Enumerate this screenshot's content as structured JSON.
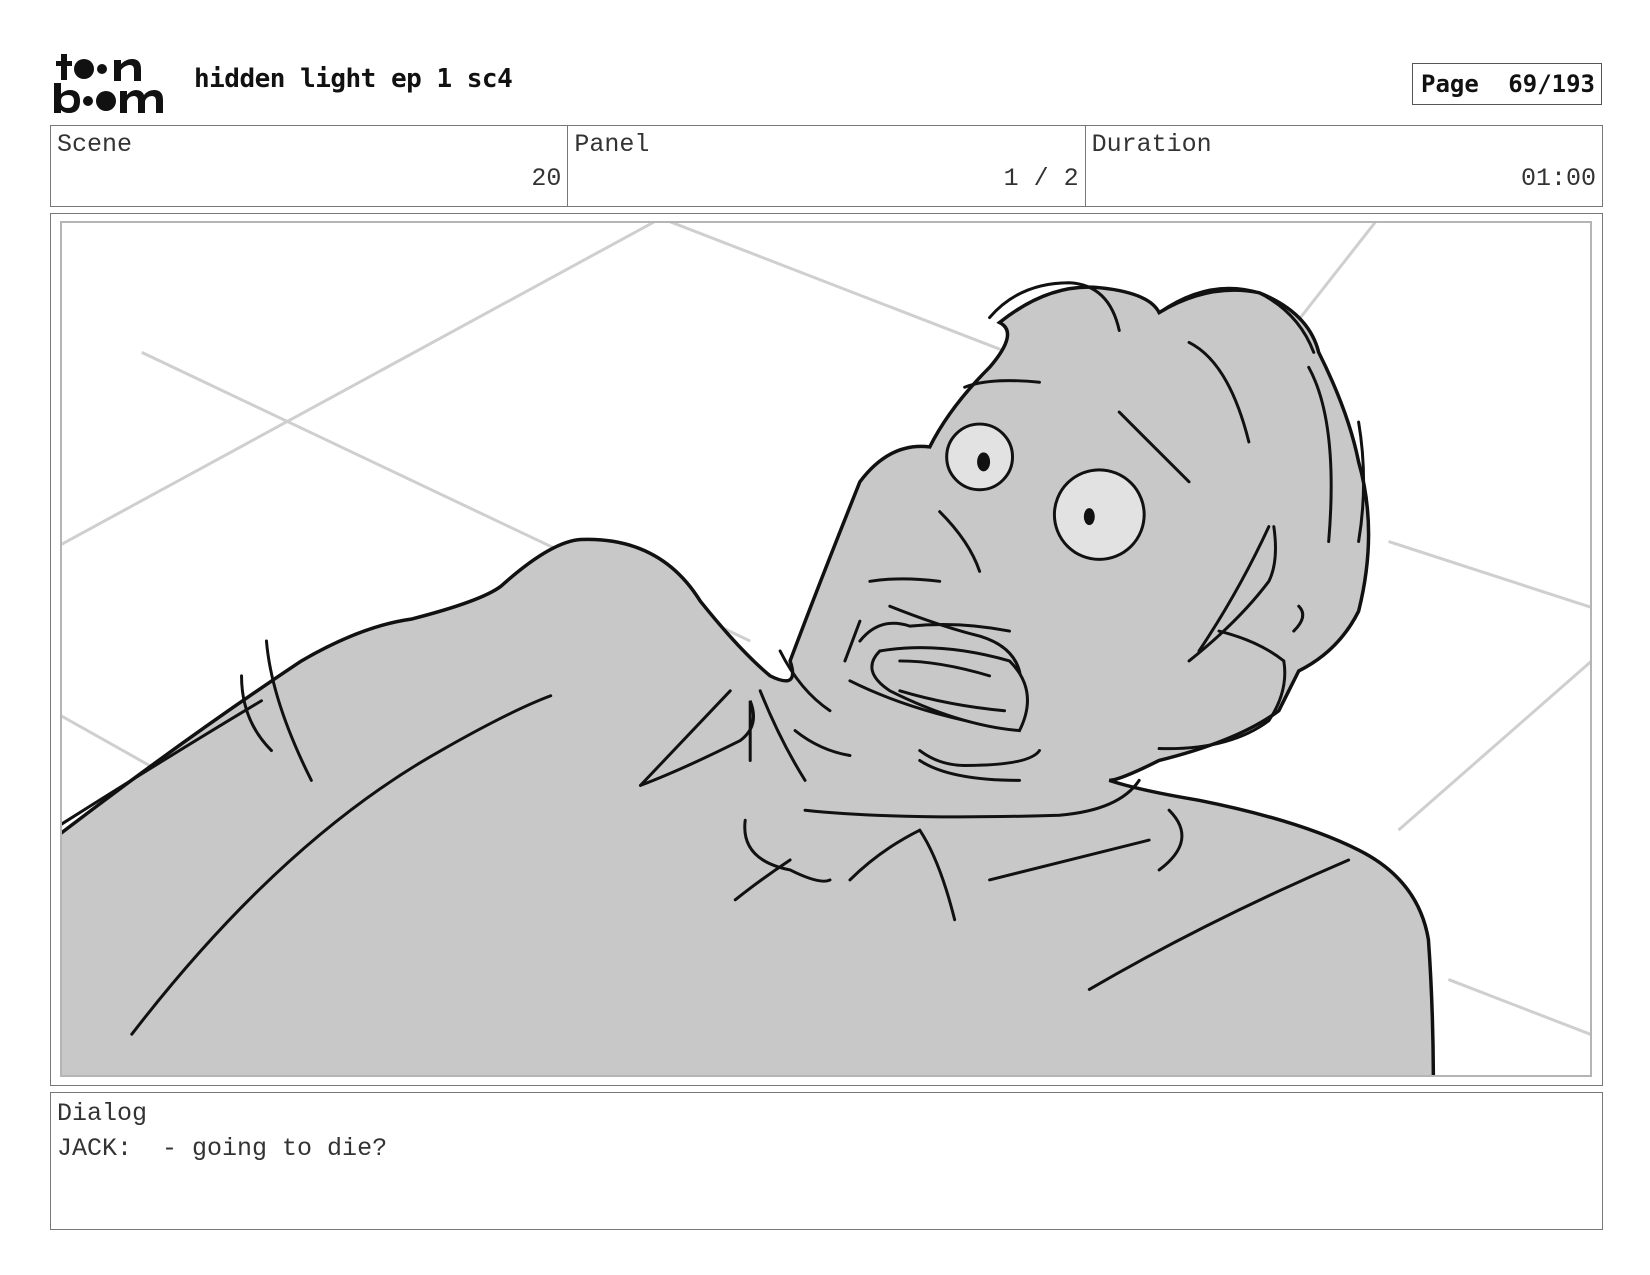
{
  "header": {
    "logo_text": "toon boom",
    "title": "hidden light ep 1 sc4",
    "page_label": "Page",
    "page_number": "69/193"
  },
  "info": {
    "scene_label": "Scene",
    "scene_value": "20",
    "panel_label": "Panel",
    "panel_value": "1 / 2",
    "duration_label": "Duration",
    "duration_value": "01:00"
  },
  "panel_image": {
    "icon": "storyboard-sketch",
    "fill_color": "#c8c8c8",
    "line_color": "#111111",
    "guide_color": "#cfcfcf"
  },
  "dialog": {
    "label": "Dialog",
    "speaker": "JACK:",
    "line": "- going to die?"
  }
}
